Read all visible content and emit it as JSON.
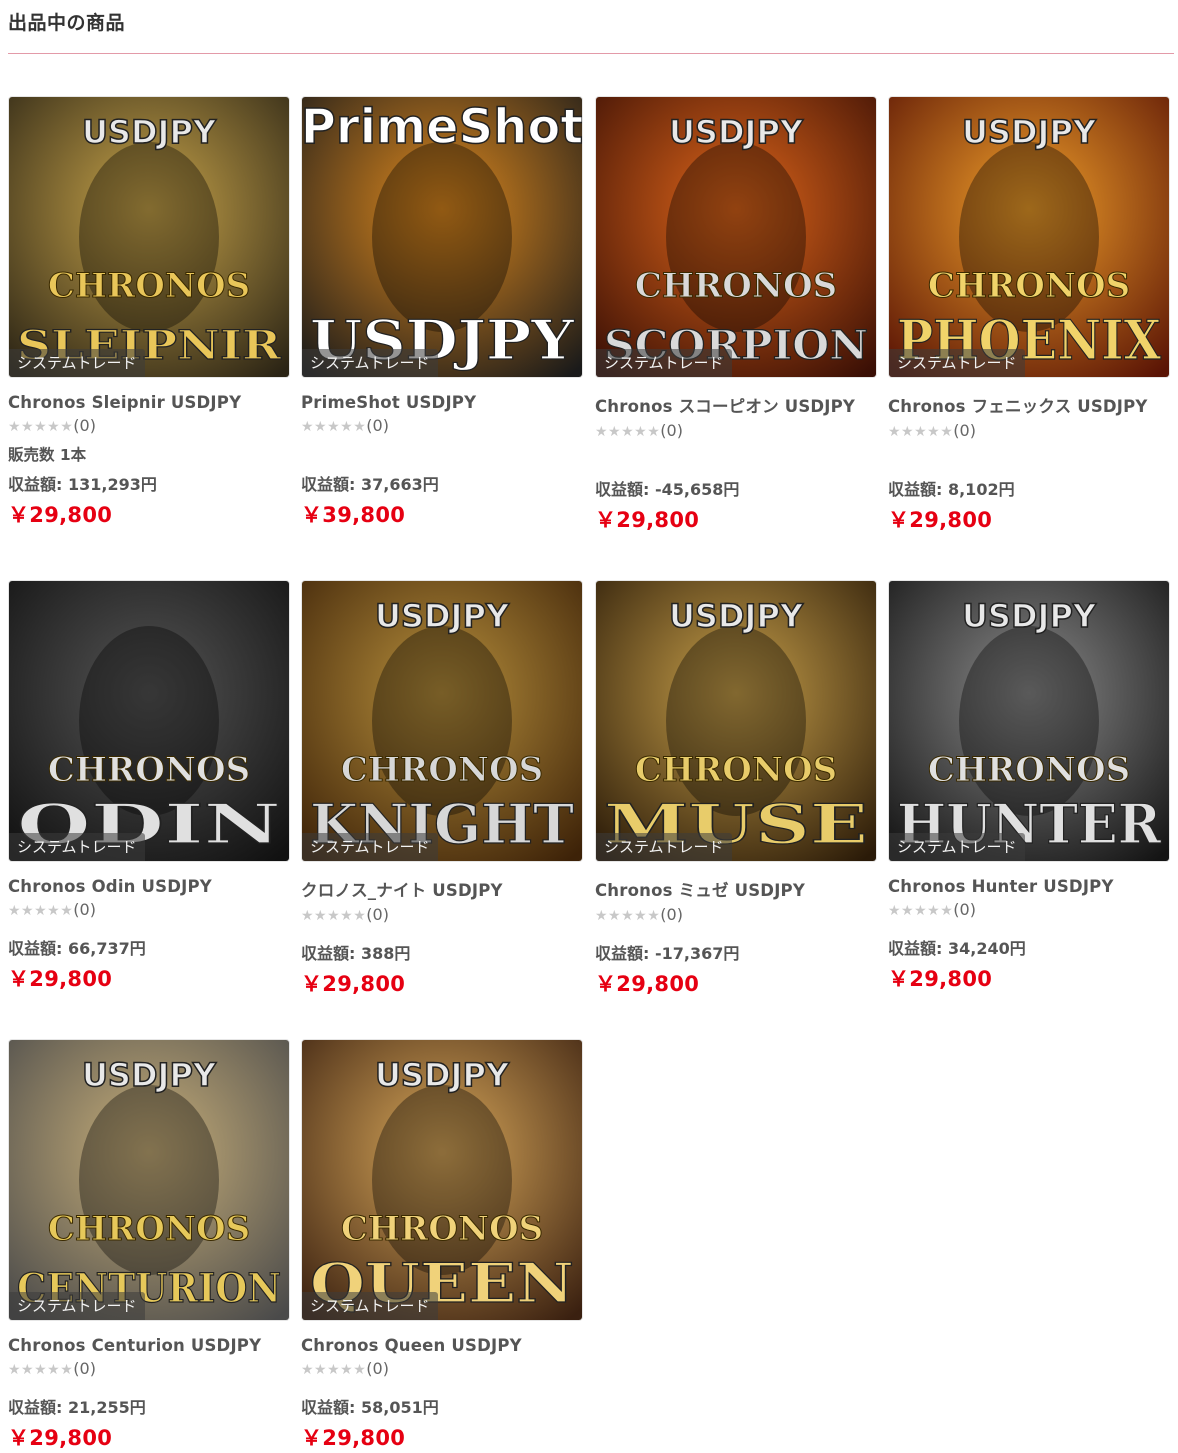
{
  "section": {
    "title": "出品中の商品"
  },
  "products": [
    {
      "name": "Chronos Sleipnir USDJPY",
      "tag": "システムトレード",
      "stars": "★★★★★",
      "reviews": "(0)",
      "sales": "販売数 1本",
      "profit": "収益額: 131,293円",
      "price": "￥29,800",
      "art": {
        "top": "USDJPY",
        "mid": "CHRONOS",
        "big": "SLEIPNIR",
        "bg1": "#2b2415",
        "bg2": "#c9a54a",
        "text": "#e9c659"
      }
    },
    {
      "name": "PrimeShot USDJPY",
      "tag": "システムトレード",
      "stars": "★★★★★",
      "reviews": "(0)",
      "sales": "",
      "profit": "収益額: 37,663円",
      "price": "￥39,800",
      "art": {
        "top": "PrimeShot",
        "mid": "",
        "big": "USDJPY",
        "bg1": "#1a1a1a",
        "bg2": "#e08a1e",
        "text": "#ffffff"
      }
    },
    {
      "name": "Chronos スコーピオン USDJPY",
      "tag": "システムトレード",
      "stars": "★★★★★",
      "reviews": "(0)",
      "sales": "",
      "profit": "収益額: -45,658円",
      "price": "￥29,800",
      "art": {
        "top": "USDJPY",
        "mid": "CHRONOS",
        "big": "SCORPION",
        "bg1": "#3a0f05",
        "bg2": "#e0661a",
        "text": "#d9d9d9"
      }
    },
    {
      "name": "Chronos フェニックス USDJPY",
      "tag": "システムトレード",
      "stars": "★★★★★",
      "reviews": "(0)",
      "sales": "",
      "profit": "収益額: 8,102円",
      "price": "￥29,800",
      "art": {
        "top": "USDJPY",
        "mid": "CHRONOS",
        "big": "PHOENIX",
        "bg1": "#5a1405",
        "bg2": "#f2a02a",
        "text": "#f0d36a"
      }
    },
    {
      "name": "Chronos Odin USDJPY",
      "tag": "システムトレード",
      "stars": "★★★★★",
      "reviews": "(0)",
      "sales": "",
      "profit": "収益額: 66,737円",
      "price": "￥29,800",
      "art": {
        "top": "",
        "mid": "CHRONOS",
        "big": "ODIN",
        "bg1": "#111111",
        "bg2": "#555555",
        "text": "#e0e0e0"
      }
    },
    {
      "name": "クロノス_ナイト USDJPY",
      "tag": "システムトレード",
      "stars": "★★★★★",
      "reviews": "(0)",
      "sales": "",
      "profit": "収益額: 388円",
      "price": "￥29,800",
      "art": {
        "top": "USDJPY",
        "mid": "CHRONOS",
        "big": "KNIGHT",
        "bg1": "#3d2208",
        "bg2": "#b8903c",
        "text": "#d7d7d7"
      }
    },
    {
      "name": "Chronos ミュゼ USDJPY",
      "tag": "システムトレード",
      "stars": "★★★★★",
      "reviews": "(0)",
      "sales": "",
      "profit": "収益額: -17,367円",
      "price": "￥29,800",
      "art": {
        "top": "USDJPY",
        "mid": "CHRONOS",
        "big": "MUSE",
        "bg1": "#2a1a08",
        "bg2": "#c8a04a",
        "text": "#e8cc6a"
      }
    },
    {
      "name": "Chronos Hunter USDJPY",
      "tag": "システムトレード",
      "stars": "★★★★★",
      "reviews": "(0)",
      "sales": "",
      "profit": "収益額: 34,240円",
      "price": "￥29,800",
      "art": {
        "top": "USDJPY",
        "mid": "CHRONOS",
        "big": "HUNTER",
        "bg1": "#141414",
        "bg2": "#8a8a8a",
        "text": "#e0e0e0"
      }
    },
    {
      "name": "Chronos Centurion USDJPY",
      "tag": "システムトレード",
      "stars": "★★★★★",
      "reviews": "(0)",
      "sales": "",
      "profit": "収益額: 21,255円",
      "price": "￥29,800",
      "art": {
        "top": "USDJPY",
        "mid": "CHRONOS",
        "big": "CENTURION",
        "bg1": "#4a4a4a",
        "bg2": "#c9b07a",
        "text": "#e6c85a"
      }
    },
    {
      "name": "Chronos Queen USDJPY",
      "tag": "システムトレード",
      "stars": "★★★★★",
      "reviews": "(0)",
      "sales": "",
      "profit": "収益額: 58,051円",
      "price": "￥29,800",
      "art": {
        "top": "USDJPY",
        "mid": "CHRONOS",
        "big": "QUEEN",
        "bg1": "#3a2010",
        "bg2": "#d9a85a",
        "text": "#f0d27a"
      }
    }
  ]
}
